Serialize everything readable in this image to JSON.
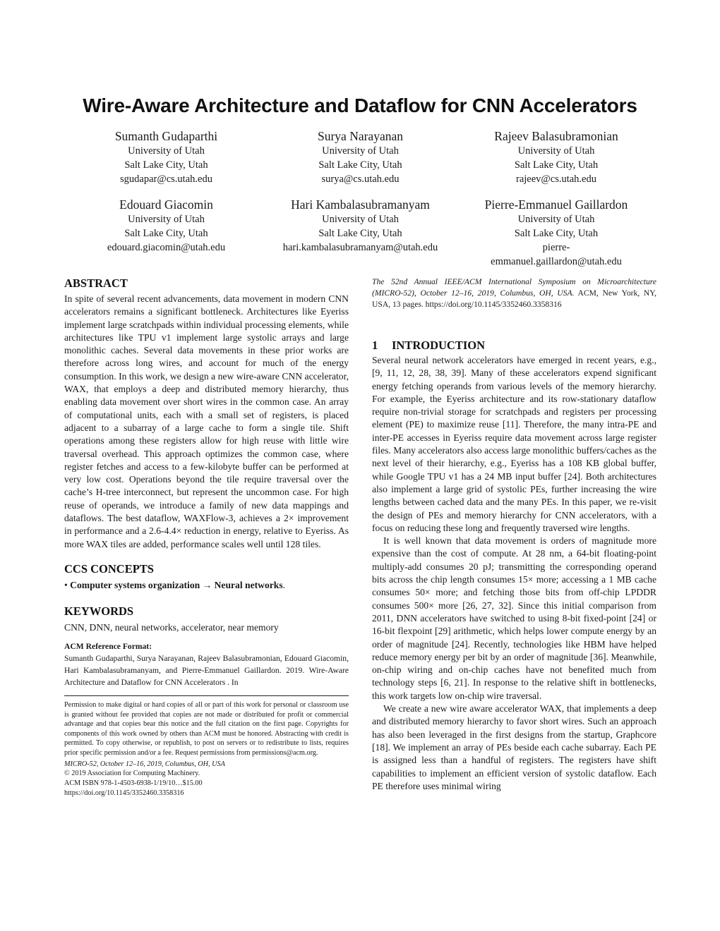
{
  "paper": {
    "title": "Wire-Aware Architecture and Dataflow for CNN Accelerators",
    "authors": [
      {
        "name": "Sumanth Gudaparthi",
        "affiliation": "University of Utah",
        "location": "Salt Lake City, Utah",
        "email": "sgudapar@cs.utah.edu"
      },
      {
        "name": "Surya Narayanan",
        "affiliation": "University of Utah",
        "location": "Salt Lake City, Utah",
        "email": "surya@cs.utah.edu"
      },
      {
        "name": "Rajeev Balasubramonian",
        "affiliation": "University of Utah",
        "location": "Salt Lake City, Utah",
        "email": "rajeev@cs.utah.edu"
      },
      {
        "name": "Edouard Giacomin",
        "affiliation": "University of Utah",
        "location": "Salt Lake City, Utah",
        "email": "edouard.giacomin@utah.edu"
      },
      {
        "name": "Hari Kambalasubramanyam",
        "affiliation": "University of Utah",
        "location": "Salt Lake City, Utah",
        "email": "hari.kambalasubramanyam@utah.edu"
      },
      {
        "name": "Pierre-Emmanuel Gaillardon",
        "affiliation": "University of Utah",
        "location": "Salt Lake City, Utah",
        "email_line1": "pierre-",
        "email_line2": "emmanuel.gaillardon@utah.edu"
      }
    ],
    "abstract": {
      "heading": "ABSTRACT",
      "text": "In spite of several recent advancements, data movement in modern CNN accelerators remains a significant bottleneck. Architectures like Eyeriss implement large scratchpads within individual processing elements, while architectures like TPU v1 implement large systolic arrays and large monolithic caches. Several data movements in these prior works are therefore across long wires, and account for much of the energy consumption. In this work, we design a new wire-aware CNN accelerator, WAX, that employs a deep and distributed memory hierarchy, thus enabling data movement over short wires in the common case. An array of computational units, each with a small set of registers, is placed adjacent to a subarray of a large cache to form a single tile. Shift operations among these registers allow for high reuse with little wire traversal overhead. This approach optimizes the common case, where register fetches and access to a few-kilobyte buffer can be performed at very low cost. Operations beyond the tile require traversal over the cache’s H-tree interconnect, but represent the uncommon case. For high reuse of operands, we introduce a family of new data mappings and dataflows. The best dataflow, WAXFlow-3, achieves a 2× improvement in performance and a 2.6-4.4× reduction in energy, relative to Eyeriss. As more WAX tiles are added, performance scales well until 128 tiles."
    },
    "ccs": {
      "heading": "CCS CONCEPTS",
      "bullet": "•",
      "concept": "Computer systems organization",
      "arrow": "→",
      "sub": "Neural networks",
      "end": "."
    },
    "keywords": {
      "heading": "KEYWORDS",
      "text": "CNN, DNN, neural networks, accelerator, near memory"
    },
    "reference_format": {
      "heading": "ACM Reference Format:",
      "text": "Sumanth Gudaparthi, Surya Narayanan, Rajeev Balasubramonian, Edouard Giacomin, Hari Kambalasubramanyam, and Pierre-Emmanuel Gaillardon. 2019. Wire-Aware Architecture and Dataflow for CNN Accelerators . In",
      "continuation_italic": "The 52nd Annual IEEE/ACM International Symposium on Microarchitecture (MICRO-52), October 12–16, 2019, Columbus, OH, USA.",
      "continuation_plain": " ACM, New York, NY, USA, 13 pages. https://doi.org/10.1145/3352460.3358316"
    },
    "permission": {
      "text": "Permission to make digital or hard copies of all or part of this work for personal or classroom use is granted without fee provided that copies are not made or distributed for profit or commercial advantage and that copies bear this notice and the full citation on the first page. Copyrights for components of this work owned by others than ACM must be honored. Abstracting with credit is permitted. To copy otherwise, or republish, to post on servers or to redistribute to lists, requires prior specific permission and/or a fee. Request permissions from permissions@acm.org.",
      "venue": "MICRO-52, October 12–16, 2019, Columbus, OH, USA",
      "copyright": "© 2019 Association for Computing Machinery.",
      "isbn": "ACM ISBN 978-1-4503-6938-1/19/10…$15.00",
      "doi": "https://doi.org/10.1145/3352460.3358316"
    },
    "introduction": {
      "number": "1",
      "heading": "INTRODUCTION",
      "paragraphs": [
        "Several neural network accelerators have emerged in recent years, e.g., [9, 11, 12, 28, 38, 39]. Many of these accelerators expend significant energy fetching operands from various levels of the memory hierarchy. For example, the Eyeriss architecture and its row-stationary dataflow require non-trivial storage for scratchpads and registers per processing element (PE) to maximize reuse [11]. Therefore, the many intra-PE and inter-PE accesses in Eyeriss require data movement across large register files. Many accelerators also access large monolithic buffers/caches as the next level of their hierarchy, e.g., Eyeriss has a 108 KB global buffer, while Google TPU v1 has a 24 MB input buffer [24]. Both architectures also implement a large grid of systolic PEs, further increasing the wire lengths between cached data and the many PEs. In this paper, we re-visit the design of PEs and memory hierarchy for CNN accelerators, with a focus on reducing these long and frequently traversed wire lengths.",
        "It is well known that data movement is orders of magnitude more expensive than the cost of compute. At 28 nm, a 64-bit floating-point multiply-add consumes 20 pJ; transmitting the corresponding operand bits across the chip length consumes 15× more; accessing a 1 MB cache consumes 50× more; and fetching those bits from off-chip LPDDR consumes 500× more [26, 27, 32]. Since this initial comparison from 2011, DNN accelerators have switched to using 8-bit fixed-point [24] or 16-bit flexpoint [29] arithmetic, which helps lower compute energy by an order of magnitude [24]. Recently, technologies like HBM have helped reduce memory energy per bit by an order of magnitude [36]. Meanwhile, on-chip wiring and on-chip caches have not benefited much from technology steps [6, 21]. In response to the relative shift in bottlenecks, this work targets low on-chip wire traversal.",
        "We create a new wire aware accelerator WAX, that implements a deep and distributed memory hierarchy to favor short wires. Such an approach has also been leveraged in the first designs from the startup, Graphcore [18]. We implement an array of PEs beside each cache subarray. Each PE is assigned less than a handful of registers. The registers have shift capabilities to implement an efficient version of systolic dataflow. Each PE therefore uses minimal wiring"
      ]
    }
  }
}
